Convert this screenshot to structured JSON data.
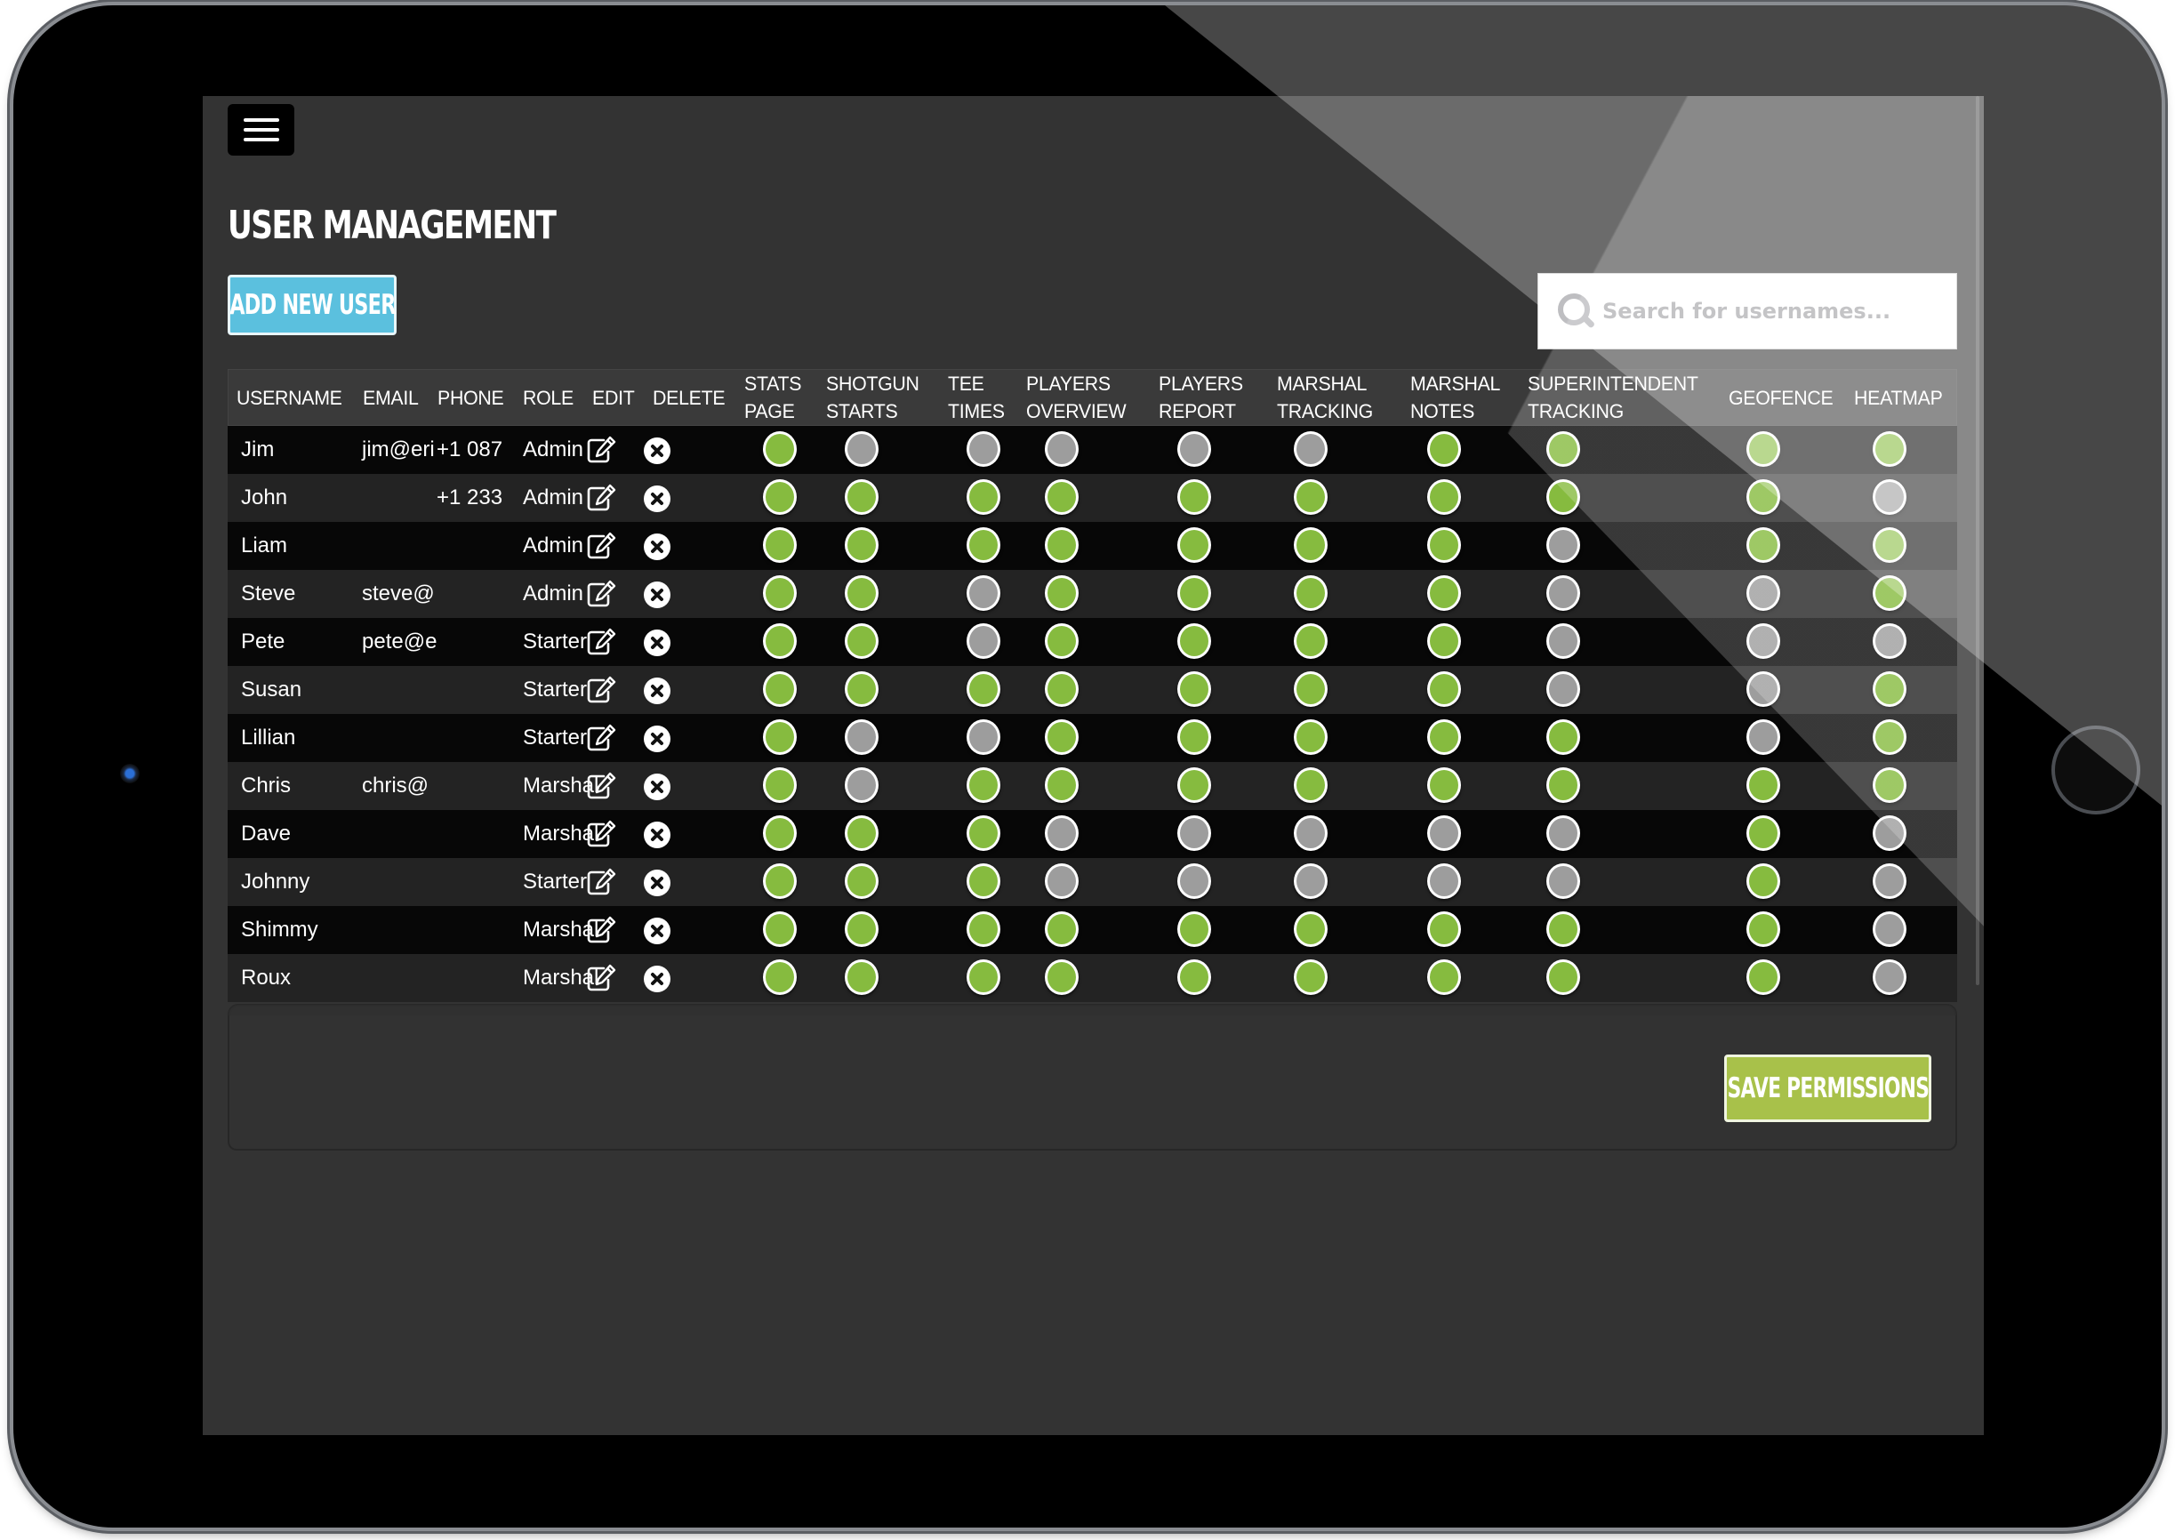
{
  "header": {
    "menu_icon": "hamburger-menu-icon",
    "title": "USER MANAGEMENT",
    "add_user_label": "ADD NEW USER"
  },
  "search": {
    "icon": "search-icon",
    "placeholder": "Search for usernames...",
    "value": ""
  },
  "table": {
    "columns": [
      {
        "key": "username",
        "label": "USERNAME"
      },
      {
        "key": "email",
        "label": "EMAIL"
      },
      {
        "key": "phone",
        "label": "PHONE"
      },
      {
        "key": "role",
        "label": "ROLE"
      },
      {
        "key": "edit",
        "label": "EDIT"
      },
      {
        "key": "delete",
        "label": "DELETE"
      },
      {
        "key": "stats_page",
        "label": "STATS PAGE"
      },
      {
        "key": "shotgun_starts",
        "label": "SHOTGUN STARTS"
      },
      {
        "key": "tee_times",
        "label": "TEE TIMES"
      },
      {
        "key": "players_overview",
        "label": "PLAYERS OVERVIEW"
      },
      {
        "key": "players_report",
        "label": "PLAYERS REPORT"
      },
      {
        "key": "marshal_tracking",
        "label": "MARSHAL TRACKING"
      },
      {
        "key": "marshal_notes",
        "label": "MARSHAL NOTES"
      },
      {
        "key": "superintendent_tracking",
        "label": "SUPERINTENDENT TRACKING"
      },
      {
        "key": "geofence",
        "label": "GEOFENCE"
      },
      {
        "key": "heatmap",
        "label": "HEATMAP"
      }
    ],
    "permission_keys": [
      "stats_page",
      "shotgun_starts",
      "tee_times",
      "players_overview",
      "players_report",
      "marshal_tracking",
      "marshal_notes",
      "superintendent_tracking",
      "geofence",
      "heatmap"
    ],
    "edit_icon": "edit-pencil-icon",
    "delete_icon": "delete-x-circle-icon",
    "rows": [
      {
        "username": "Jim",
        "email": "jim@eri",
        "phone": "+1 087",
        "role": "Admin",
        "permissions": [
          true,
          false,
          false,
          false,
          false,
          false,
          true,
          true,
          true,
          true
        ]
      },
      {
        "username": "John",
        "email": "",
        "phone": "+1 233",
        "role": "Admin",
        "permissions": [
          true,
          true,
          true,
          true,
          true,
          true,
          true,
          true,
          true,
          false
        ]
      },
      {
        "username": "Liam",
        "email": "",
        "phone": "",
        "role": "Admin",
        "permissions": [
          true,
          true,
          true,
          true,
          true,
          true,
          true,
          false,
          true,
          true
        ]
      },
      {
        "username": "Steve",
        "email": "steve@",
        "phone": "",
        "role": "Admin",
        "permissions": [
          true,
          true,
          false,
          true,
          true,
          true,
          true,
          false,
          false,
          true
        ]
      },
      {
        "username": "Pete",
        "email": "pete@e",
        "phone": "",
        "role": "Starter",
        "permissions": [
          true,
          true,
          false,
          true,
          true,
          true,
          true,
          false,
          false,
          false
        ]
      },
      {
        "username": "Susan",
        "email": "",
        "phone": "",
        "role": "Starter",
        "permissions": [
          true,
          true,
          true,
          true,
          true,
          true,
          true,
          false,
          false,
          true
        ]
      },
      {
        "username": "Lillian",
        "email": "",
        "phone": "",
        "role": "Starter",
        "permissions": [
          true,
          false,
          false,
          true,
          true,
          true,
          true,
          true,
          false,
          true
        ]
      },
      {
        "username": "Chris",
        "email": "chris@",
        "phone": "",
        "role": "Marshal",
        "permissions": [
          true,
          false,
          true,
          true,
          true,
          true,
          true,
          true,
          true,
          true
        ]
      },
      {
        "username": "Dave",
        "email": "",
        "phone": "",
        "role": "Marshal",
        "permissions": [
          true,
          true,
          true,
          false,
          false,
          false,
          false,
          false,
          true,
          false
        ]
      },
      {
        "username": "Johnny",
        "email": "",
        "phone": "",
        "role": "Starter",
        "permissions": [
          true,
          true,
          true,
          false,
          false,
          false,
          false,
          false,
          true,
          false
        ]
      },
      {
        "username": "Shimmy",
        "email": "",
        "phone": "",
        "role": "Marshal",
        "permissions": [
          true,
          true,
          true,
          true,
          true,
          true,
          true,
          true,
          true,
          false
        ]
      },
      {
        "username": "Roux",
        "email": "",
        "phone": "",
        "role": "Marshal",
        "permissions": [
          true,
          true,
          true,
          true,
          true,
          true,
          true,
          true,
          true,
          false
        ]
      }
    ]
  },
  "footer": {
    "save_label": "SAVE PERMISSIONS"
  },
  "colors": {
    "toggle_on": "#86bb3f",
    "toggle_off": "#9d9d9d",
    "add_button": "#5bc0de",
    "save_button": "#a8c14a",
    "screen_bg": "#333333"
  }
}
